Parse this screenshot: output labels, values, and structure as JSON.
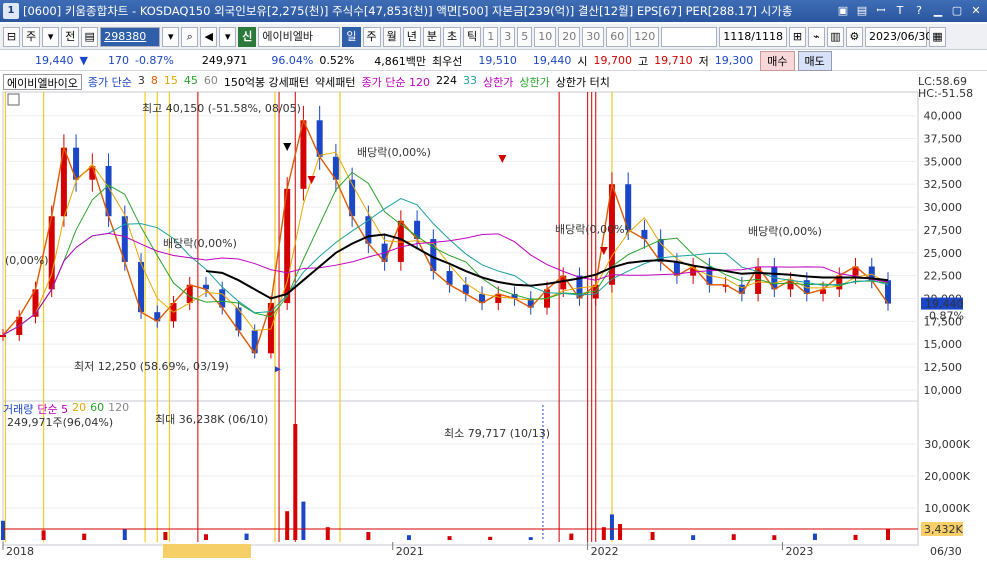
{
  "titlebar": {
    "window_number": "1",
    "title": "[0600] 키움종합차트 - KOSDAQ150 외국인보유[2,275(천)] 주식수[47,853(천)] 액면[500] 자본금[239(억)] 결산[12월] EPS[67] PER[288.17] 시가총",
    "icons": [
      "layout-icon",
      "save-icon",
      "bold-icon",
      "text-icon",
      "help-icon",
      "minimize-icon",
      "maximize-icon",
      "close-icon"
    ]
  },
  "toolbar": {
    "period": "주",
    "prev_label": "전",
    "code": "298380",
    "badge": "신",
    "stock_name": "에이비엘바",
    "intervals": [
      "일",
      "주",
      "월",
      "년",
      "분",
      "초",
      "틱"
    ],
    "numbers": [
      "1",
      "3",
      "5",
      "10",
      "20",
      "30",
      "60",
      "120"
    ],
    "count": "1118",
    "total": "/1118",
    "date": "2023/06/30"
  },
  "quote": {
    "price": "19,440",
    "arrow": "▼",
    "change": "170",
    "change_pct": "-0.87%",
    "volume": "249,971",
    "vol_ratio": "96.04%",
    "turnover": "0.52%",
    "amount": "4,861백만",
    "best_label": "최우선",
    "best_ask": "19,510",
    "best_bid": "19,440",
    "open_label": "시",
    "open": "19,700",
    "high_label": "고",
    "high": "19,710",
    "low_label": "저",
    "low": "19,300",
    "buy": "매수",
    "sell": "매도"
  },
  "legend": {
    "stock": "에이비엘바이오",
    "ma_label": "종가 단순",
    "ma_periods": [
      "3",
      "8",
      "15",
      "45",
      "60"
    ],
    "item1": "150억봉 강세패턴",
    "item2": "약세패턴",
    "ma2_label": "종가 단순 120",
    "ma2_value": "224",
    "ma2_extra": "33",
    "upper_limit": "상한가",
    "upper_limit2": "상한가",
    "upper_touch": "상한가 터치"
  },
  "volume_legend": {
    "label": "거래량",
    "ma": "단순 5",
    "p20": "20",
    "p60": "60",
    "p120": "120",
    "current": "249,971주(96,04%)"
  },
  "colors": {
    "up": "#d40000",
    "down": "#1a46c8",
    "ma3": "#e6a800",
    "ma8": "#e05a00",
    "ma15": "#2aa32a",
    "ma45": "#1aa0a0",
    "ma60": "#888888",
    "ma120": "#c000c0",
    "ma224": "#000000",
    "limit_up": "#f2c200",
    "highlight": "#f7cf68"
  },
  "annotations": {
    "high": "최고 40,150 (-51.58%, 08/05)",
    "low": "최저 12,250 (58.69%, 03/19)",
    "dividend": "배당락(0,00%)",
    "left_pct": "(0,00%)",
    "vol_max": "최대 36,238K (06/10)",
    "vol_min": "최소 79,717 (10/13)",
    "lc": "LC:58.69",
    "hc": "HC:-51.58",
    "price_tag": "19,440",
    "price_pct": "-0.87%",
    "vol_tag": "3,432K",
    "right_date": "06/30"
  },
  "chart_data": [
    {
      "type": "line",
      "name": "price",
      "x_labels": [
        "2018",
        "2021",
        "2022",
        "2023"
      ],
      "y_ticks": [
        "40,000",
        "37,500",
        "35,000",
        "32,500",
        "30,000",
        "27,500",
        "25,000",
        "22,500",
        "20,000",
        "17,500",
        "15,000",
        "12,500",
        "10,000"
      ],
      "ylim": [
        9000,
        41500
      ],
      "x": [
        0,
        4,
        8,
        12,
        15,
        18,
        22,
        26,
        30,
        34,
        38,
        42,
        46,
        50,
        54,
        58,
        62,
        66,
        70,
        74,
        78,
        82,
        86,
        90,
        94,
        98,
        102,
        106,
        110,
        114,
        118,
        122,
        126,
        130,
        134,
        138,
        142,
        146,
        150,
        154,
        158,
        162,
        166,
        170,
        174,
        178,
        182,
        186,
        190,
        194,
        198,
        202,
        206,
        210,
        214,
        218
      ],
      "values": [
        16000,
        18000,
        21000,
        29000,
        36500,
        33000,
        34500,
        29000,
        24000,
        18500,
        17500,
        19500,
        21500,
        21000,
        19000,
        16500,
        14000,
        19500,
        32000,
        39500,
        35500,
        33000,
        29000,
        26000,
        24000,
        28500,
        26500,
        23000,
        21500,
        20500,
        19500,
        20500,
        20000,
        19000,
        21000,
        22500,
        20000,
        21500,
        32500,
        27500,
        26500,
        24000,
        22500,
        23500,
        21500,
        21500,
        20500,
        23500,
        21000,
        22000,
        20500,
        21000,
        22500,
        23500,
        22000,
        19440
      ],
      "ma224": [
        null,
        null,
        null,
        null,
        null,
        null,
        null,
        null,
        null,
        null,
        null,
        null,
        null,
        23000,
        22800,
        22000,
        21000,
        20000,
        20500,
        22000,
        23500,
        25000,
        26000,
        26800,
        27000,
        26500,
        25500,
        24500,
        23800,
        23000,
        22300,
        21800,
        21500,
        21400,
        21600,
        21900,
        22200,
        22600,
        23400,
        23900,
        24100,
        24200,
        24000,
        23600,
        23300,
        23000,
        22700,
        22800,
        22700,
        22600,
        22400,
        22300,
        22300,
        22300,
        22200,
        22000
      ]
    },
    {
      "type": "bar",
      "name": "volume",
      "y_ticks": [
        "30,000K",
        "20,000K",
        "10,000K"
      ],
      "ylim": [
        0,
        40000
      ],
      "x": [
        0,
        10,
        20,
        30,
        40,
        50,
        60,
        70,
        72,
        74,
        80,
        90,
        100,
        110,
        120,
        130,
        140,
        148,
        150,
        152,
        160,
        170,
        180,
        190,
        200,
        210,
        218
      ],
      "values": [
        6000,
        3000,
        2000,
        3500,
        2500,
        1800,
        2000,
        9000,
        36238,
        12000,
        4000,
        2500,
        1500,
        1200,
        1000,
        900,
        2000,
        4000,
        8000,
        5000,
        2500,
        1500,
        1800,
        1500,
        2000,
        1600,
        3432
      ]
    }
  ]
}
